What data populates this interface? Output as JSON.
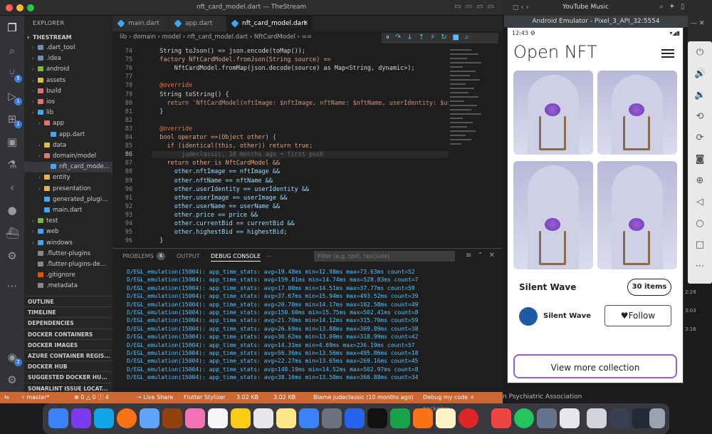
{
  "vscode": {
    "title": "nft_card_model.dart — TheStream",
    "activity_badges": {
      "scm": "5",
      "run": "1",
      "ext": "1",
      "account": "2"
    },
    "explorer": {
      "header": "EXPLORER",
      "project": "THESTREAM",
      "tree": [
        {
          "label": ".dart_tool",
          "depth": 1,
          "type": "folder",
          "color": "#6b8fb3"
        },
        {
          "label": ".idea",
          "depth": 1,
          "type": "folder",
          "color": "#6b8fb3"
        },
        {
          "label": "android",
          "depth": 1,
          "type": "folder",
          "color": "#7cb342"
        },
        {
          "label": "assets",
          "depth": 1,
          "type": "folder",
          "color": "#e0b84b"
        },
        {
          "label": "build",
          "depth": 1,
          "type": "folder",
          "color": "#e57373"
        },
        {
          "label": "ios",
          "depth": 1,
          "type": "folder",
          "color": "#e57373"
        },
        {
          "label": "lib",
          "depth": 1,
          "type": "folder",
          "color": "#42a5f5"
        },
        {
          "label": "app",
          "depth": 2,
          "type": "folder",
          "color": "#e57373"
        },
        {
          "label": "app.dart",
          "depth": 3,
          "type": "file",
          "color": "#42a5f5"
        },
        {
          "label": "data",
          "depth": 2,
          "type": "folder",
          "color": "#e0b84b"
        },
        {
          "label": "domain/model",
          "depth": 2,
          "type": "folder",
          "color": "#e57373"
        },
        {
          "label": "nft_card_mode...",
          "depth": 3,
          "type": "file",
          "color": "#42a5f5",
          "selected": true
        },
        {
          "label": "entity",
          "depth": 2,
          "type": "folder",
          "color": "#e0b84b"
        },
        {
          "label": "presentation",
          "depth": 2,
          "type": "folder",
          "color": "#e0b84b"
        },
        {
          "label": "generated_plugi...",
          "depth": 2,
          "type": "file",
          "color": "#42a5f5"
        },
        {
          "label": "main.dart",
          "depth": 2,
          "type": "file",
          "color": "#42a5f5"
        },
        {
          "label": "test",
          "depth": 1,
          "type": "folder",
          "color": "#7cb342"
        },
        {
          "label": "web",
          "depth": 1,
          "type": "folder",
          "color": "#42a5f5"
        },
        {
          "label": "windows",
          "depth": 1,
          "type": "folder",
          "color": "#42a5f5"
        },
        {
          "label": ".flutter-plugins",
          "depth": 1,
          "type": "file",
          "color": "#888888"
        },
        {
          "label": ".flutter-plugins-de...",
          "depth": 1,
          "type": "file",
          "color": "#888888"
        },
        {
          "label": ".gitignore",
          "depth": 1,
          "type": "file",
          "color": "#e65100"
        },
        {
          "label": ".metadata",
          "depth": 1,
          "type": "file",
          "color": "#888888"
        }
      ],
      "sections": [
        "OUTLINE",
        "TIMELINE",
        "DEPENDENCIES",
        "DOCKER CONTAINERS",
        "DOCKER IMAGES",
        "AZURE CONTAINER REGIS...",
        "DOCKER HUB",
        "SUGGESTED DOCKER HU...",
        "SONARLINT ISSUE LOCAT..."
      ]
    },
    "tabs": [
      {
        "label": "main.dart"
      },
      {
        "label": "app.dart"
      },
      {
        "label": "nft_card_model.dart",
        "active": true
      }
    ],
    "breadcrumb": "lib › domain › model › nft_card_model.dart › NftCardModel › ==",
    "code": [
      {
        "n": "74",
        "t": "  String toJson() => json.encode(toMap());"
      },
      {
        "n": "75",
        "t": "  factory NftCardModel.fromJson(String source) =>"
      },
      {
        "n": "76",
        "t": "      NftCardModel.fromMap(json.decode(source) as Map<String, dynamic>);"
      },
      {
        "n": "77",
        "t": ""
      },
      {
        "n": "78",
        "t": "  @override"
      },
      {
        "n": "79",
        "t": "  String toString() {"
      },
      {
        "n": "80",
        "t": "    return 'NftCardModel(nftImage: $nftImage, nftName: $nftName, userIdentity: $userI"
      },
      {
        "n": "81",
        "t": "  }"
      },
      {
        "n": "82",
        "t": ""
      },
      {
        "n": "83",
        "t": "  @override"
      },
      {
        "n": "84",
        "t": "  bool operator ==(Object other) {"
      },
      {
        "n": "85",
        "t": "    if (identical(this, other)) return true;"
      },
      {
        "n": "86",
        "t": "        judeclassic, 10 months ago • first push"
      },
      {
        "n": "87",
        "t": "    return other is NftCardModel &&"
      },
      {
        "n": "88",
        "t": "      other.nftImage == nftImage &&"
      },
      {
        "n": "89",
        "t": "      other.nftName == nftName &&"
      },
      {
        "n": "90",
        "t": "      other.userIdentity == userIdentity &&"
      },
      {
        "n": "91",
        "t": "      other.userImage == userImage &&"
      },
      {
        "n": "92",
        "t": "      other.userName == userName &&"
      },
      {
        "n": "93",
        "t": "      other.price == price &&"
      },
      {
        "n": "94",
        "t": "      other.currentBid == currentBid &&"
      },
      {
        "n": "95",
        "t": "      other.highestBid == highestBid;"
      },
      {
        "n": "96",
        "t": "  }"
      }
    ],
    "panel": {
      "tabs": [
        "PROBLEMS",
        "OUTPUT",
        "DEBUG CONSOLE"
      ],
      "problems_count": "4",
      "filter_placeholder": "Filter (e.g. text, !exclude)",
      "lines": [
        "D/EGL_emulation(15004): app_time_stats: avg=19.48ms min=12.98ms max=73.63ms count=52",
        "D/EGL_emulation(15004): app_time_stats: avg=159.01ms min=14.74ms max=528.83ms count=7",
        "D/EGL_emulation(15004): app_time_stats: avg=17.00ms min=14.51ms max=37.77ms count=59",
        "D/EGL_emulation(15004): app_time_stats: avg=37.67ms min=15.94ms max=493.52ms count=39",
        "D/EGL_emulation(15004): app_time_stats: avg=20.70ms min=14.17ms max=102.58ms count=49",
        "D/EGL_emulation(15004): app_time_stats: avg=150.60ms min=15.75ms max=502.41ms count=8",
        "D/EGL_emulation(15004): app_time_stats: avg=21.70ms min=14.12ms max=315.70ms count=59",
        "D/EGL_emulation(15004): app_time_stats: avg=26.69ms min=13.88ms max=369.89ms count=38",
        "D/EGL_emulation(15004): app_time_stats: avg=30.62ms min=13.09ms max=318.99ms count=42",
        "D/EGL_emulation(15004): app_time_stats: avg=14.31ms min=4.69ms max=236.19ms count=57",
        "D/EGL_emulation(15004): app_time_stats: avg=56.36ms min=13.56ms max=495.86ms count=18",
        "D/EGL_emulation(15004): app_time_stats: avg=22.27ms min=13.65ms max=269.16ms count=45",
        "D/EGL_emulation(15004): app_time_stats: avg=148.19ms min=14.52ms max=502.97ms count=8",
        "D/EGL_emulation(15004): app_time_stats: avg=38.16ms min=13.50ms max=366.88ms count=34"
      ]
    },
    "status": {
      "branch": "master*",
      "errors": "⊗ 0 △ 0 ⓘ 4",
      "live_share": "Live Share",
      "stylizer": "Flutter Stylizer",
      "size1": "3.02 KB",
      "size2": "3.02 KB",
      "blame": "Blame judeclassic (10 months ago)",
      "debug": "Debug my code + packages"
    }
  },
  "browser": {
    "tab": "YouTube Music"
  },
  "emulator": {
    "title": "Android Emulator - Pixel_3_API_32:5554",
    "status_time": "12:43",
    "app": {
      "title": "Open NFT",
      "collection_name": "Silent Wave",
      "items": "30 items",
      "user_name": "Silent Wave",
      "follow": "Follow",
      "view_more": "View more collection"
    }
  },
  "behind": {
    "psych": "n Psychiatric Association",
    "t1": "2:28",
    "t2": "3:03",
    "t3": "3:16"
  }
}
